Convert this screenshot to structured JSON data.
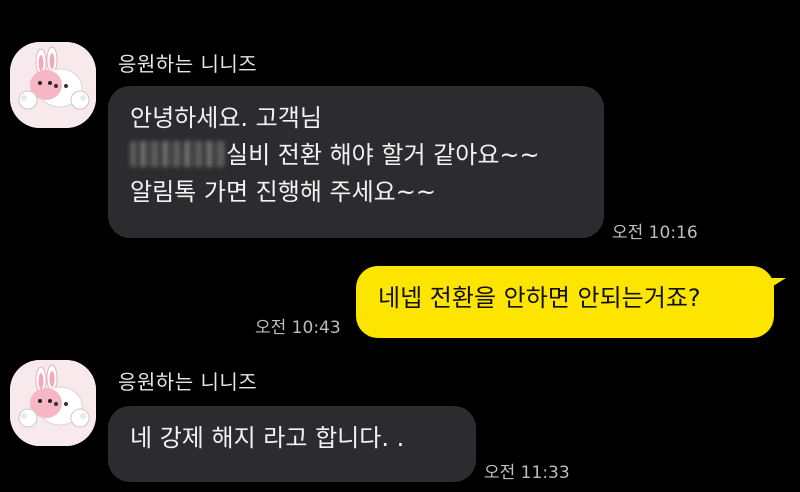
{
  "colors": {
    "background": "#000000",
    "incoming_bubble": "#2c2c2e",
    "outgoing_bubble": "#fee500"
  },
  "messages": [
    {
      "sender": "응원하는 니니즈",
      "lines": [
        "안녕하세요. 고객님",
        "실비 전환 해야 할거 같아요~~",
        "알림톡 가면 진행해 주세요~~"
      ],
      "time": "오전 10:16",
      "avatar_icon": "ninis-bunny-avatar-icon"
    },
    {
      "text": "네넵 전환을 안하면 안되는거죠?",
      "time": "오전 10:43"
    },
    {
      "sender": "응원하는 니니즈",
      "lines": [
        "네 강제 해지 라고 합니다. ."
      ],
      "time": "오전 11:33",
      "avatar_icon": "ninis-bunny-avatar-icon"
    }
  ]
}
